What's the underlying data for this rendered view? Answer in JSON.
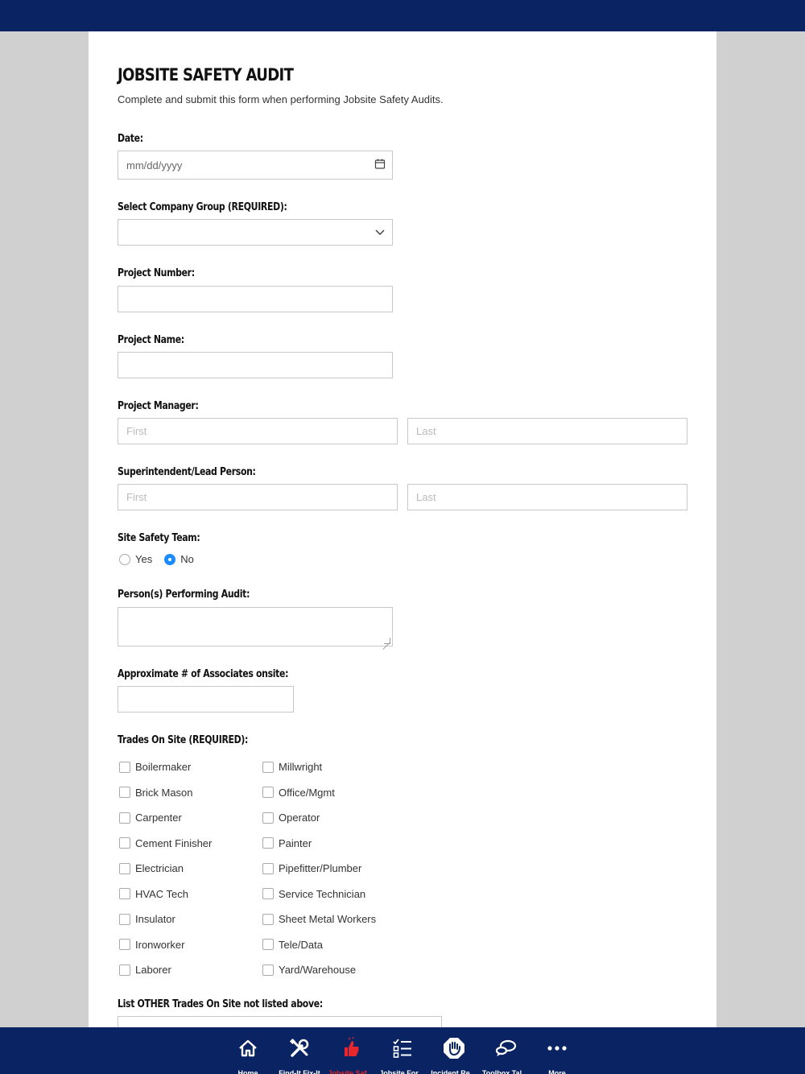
{
  "form": {
    "title": "JOBSITE SAFETY AUDIT",
    "subtitle": "Complete and submit this form when performing Jobsite Safety Audits.",
    "date_label": "Date:",
    "date_placeholder": "mm/dd/yyyy",
    "company_label": "Select Company Group (REQUIRED):",
    "company_value": "",
    "project_number_label": "Project Number:",
    "project_name_label": "Project Name:",
    "pm_label": "Project Manager:",
    "pm_first_placeholder": "First",
    "pm_last_placeholder": "Last",
    "super_label": "Superintendent/Lead Person:",
    "super_first_placeholder": "First",
    "super_last_placeholder": "Last",
    "safety_team_label": "Site Safety Team:",
    "safety_team_yes": "Yes",
    "safety_team_no": "No",
    "safety_team_selected": "No",
    "performers_label": "Person(s) Performing Audit:",
    "associates_label": "Approximate # of Associates onsite:",
    "trades_label": "Trades On Site (REQUIRED):",
    "trades_col1": [
      "Boilermaker",
      "Brick Mason",
      "Carpenter",
      "Cement Finisher",
      "Electrician",
      "HVAC Tech",
      "Insulator",
      "Ironworker",
      "Laborer"
    ],
    "trades_col2": [
      "Millwright",
      "Office/Mgmt",
      "Operator",
      "Painter",
      "Pipefitter/Plumber",
      "Service Technician",
      "Sheet Metal Workers",
      "Tele/Data",
      "Yard/Warehouse"
    ],
    "other_trades_label": "List OTHER Trades On Site not listed above:"
  },
  "nav": {
    "items": [
      {
        "label": "Home",
        "icon": "home-icon"
      },
      {
        "label": "Find-It Fix-It",
        "icon": "tools-icon"
      },
      {
        "label": "Jobsite Saf…",
        "icon": "thumbs-up-icon",
        "active": true
      },
      {
        "label": "Jobsite For…",
        "icon": "checklist-icon"
      },
      {
        "label": "Incident Re…",
        "icon": "stop-hand-icon"
      },
      {
        "label": "Toolbox Tal…",
        "icon": "chat-icon"
      },
      {
        "label": "More",
        "icon": "more-icon"
      }
    ]
  },
  "colors": {
    "brand_navy": "#0a2463",
    "active_red": "#e8262c",
    "radio_blue": "#1a8cff"
  }
}
